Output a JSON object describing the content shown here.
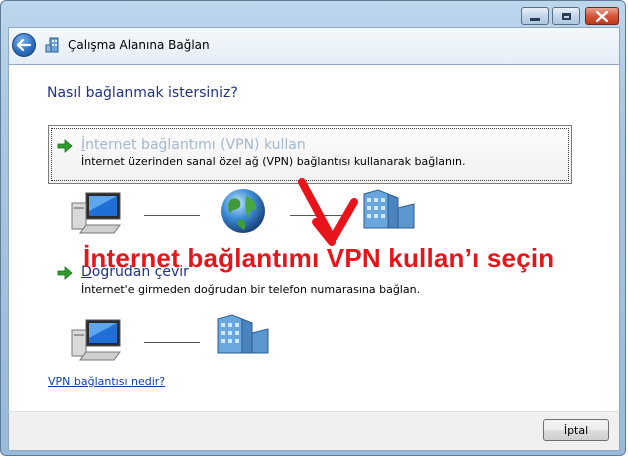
{
  "window": {
    "title": "Çalışma Alanına Bağlan",
    "controls": {
      "minimize": "minimize-icon",
      "maximize": "maximize-icon",
      "close": "close-icon"
    }
  },
  "heading": "Nasıl bağlanmak istersiniz?",
  "options": [
    {
      "title_hot": "İ",
      "title_rest": "nternet bağlantımı (VPN) kullan",
      "description": "İnternet üzerinden sanal özel ağ (VPN) bağlantısı kullanarak bağlanın.",
      "icons": [
        "computer-icon",
        "globe-icon",
        "office-building-icon"
      ]
    },
    {
      "title_hot": "D",
      "title_rest": "oğrudan çevir",
      "description": "İnternet'e girmeden doğrudan bir telefon numarasına bağlan.",
      "icons": [
        "computer-icon",
        "office-building-icon"
      ]
    }
  ],
  "annotation": {
    "text": "İnternet bağlantımı VPN kullan’ı seçin",
    "color": "#e8141a"
  },
  "help_link": "VPN bağlantısı nedir?",
  "buttons": {
    "cancel": "İptal"
  },
  "colors": {
    "heading": "#1e3287",
    "link": "#0b3cb5",
    "arrow_green": "#2e9e2e"
  }
}
